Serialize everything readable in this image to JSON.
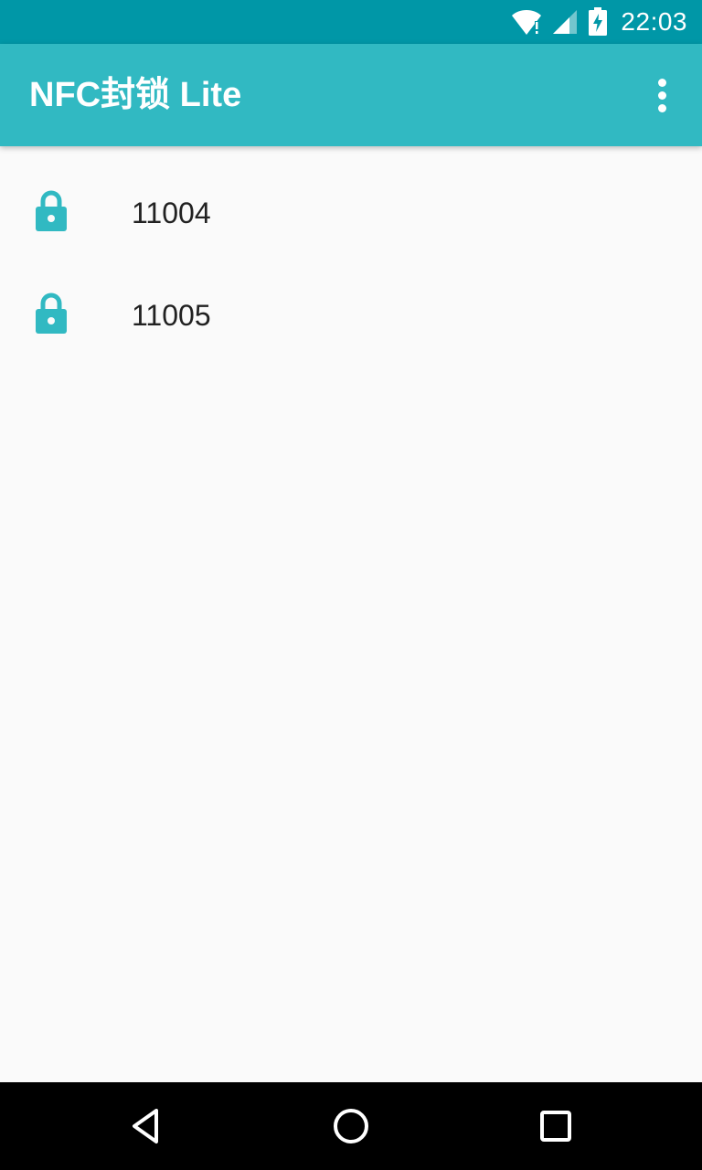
{
  "status_bar": {
    "time": "22:03",
    "icons": [
      "wifi-alert-icon",
      "cellular-signal-icon",
      "battery-charging-icon"
    ]
  },
  "app_bar": {
    "title": "NFC封锁 Lite",
    "overflow_icon": "more-vert-icon"
  },
  "locks": [
    {
      "label": "11004",
      "icon": "lock-icon"
    },
    {
      "label": "11005",
      "icon": "lock-icon"
    }
  ],
  "nav_bar": {
    "buttons": [
      "back-icon",
      "home-icon",
      "recents-icon"
    ]
  },
  "colors": {
    "status_bar": "#0097a7",
    "app_bar": "#31b9c2",
    "accent": "#31b9c2",
    "background": "#fafafa",
    "nav_bar": "#000000"
  }
}
